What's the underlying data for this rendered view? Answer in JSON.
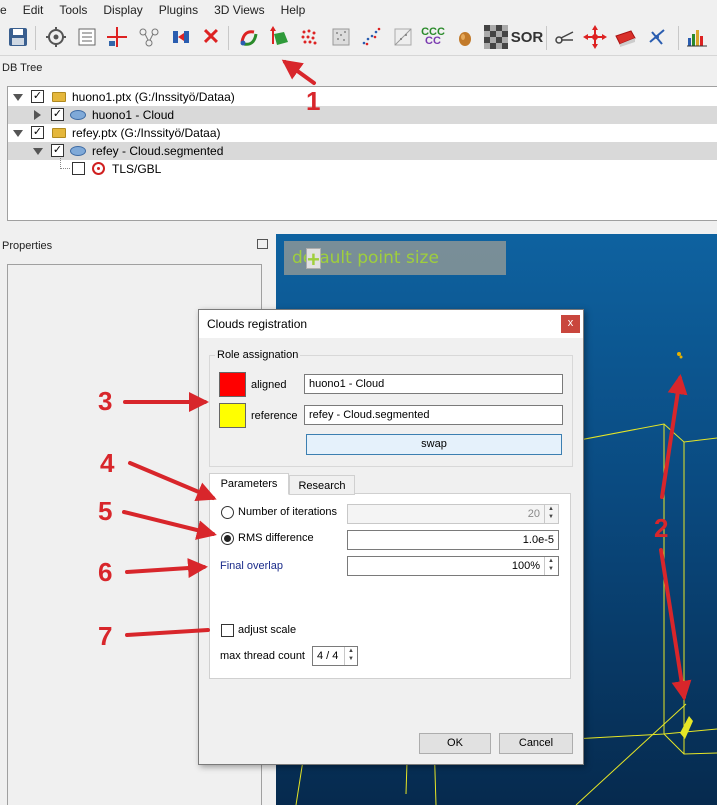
{
  "menu": [
    "e",
    "Edit",
    "Tools",
    "Display",
    "Plugins",
    "3D Views",
    "Help"
  ],
  "toolbar_icons": [
    "save-icon",
    "settings-icon",
    "list-icon",
    "point-pick-icon",
    "graph-icon",
    "export-icon",
    "delete-icon",
    "register-icon",
    "normals-icon",
    "color-icon",
    "sample-icon",
    "density-icon",
    "noise-icon",
    "ccc-icon",
    "leaf-icon",
    "grid-icon",
    "sor-icon",
    "scissors-icon",
    "move-icon",
    "plane-icon",
    "star-icon",
    "histogram-icon"
  ],
  "toolbar_text": {
    "ccc": "CCC",
    "sor": "SOR"
  },
  "dbtree": {
    "title": "DB Tree",
    "rows": [
      {
        "label": "huono1.ptx (G:/Inssityö/Dataa)",
        "checked": "✓"
      },
      {
        "label": "huono1 - Cloud",
        "checked": "✓"
      },
      {
        "label": "refey.ptx (G:/Inssityö/Dataa)",
        "checked": "✓"
      },
      {
        "label": "refey - Cloud.segmented",
        "checked": "✓"
      },
      {
        "label": "TLS/GBL",
        "checked": ""
      }
    ]
  },
  "properties": {
    "title": "Properties"
  },
  "view3d": {
    "point_size_label": "default point size",
    "minus": "−",
    "plus": "+"
  },
  "dialog": {
    "title": "Clouds registration",
    "close": "x",
    "role_group": "Role assignation",
    "aligned_label": "aligned",
    "aligned_value": "huono1 - Cloud",
    "aligned_color": "#ff0000",
    "reference_label": "reference",
    "reference_value": "refey - Cloud.segmented",
    "reference_color": "#ffff00",
    "swap": "swap",
    "tabs": [
      "Parameters",
      "Research"
    ],
    "iterations_label": "Number of iterations",
    "iterations_value": "20",
    "rms_label": "RMS difference",
    "rms_value": "1.0e-5",
    "overlap_label": "Final overlap",
    "overlap_value": "100%",
    "adjust_scale_label": "adjust scale",
    "thread_label": "max thread count",
    "thread_value": "4 / 4",
    "ok": "OK",
    "cancel": "Cancel"
  },
  "annotations": [
    "1",
    "2",
    "3",
    "4",
    "5",
    "6",
    "7"
  ],
  "colors": {
    "annotation": "#d8262b",
    "view_bg": "#0a4a80",
    "overlay_text": "#9fcf3c"
  }
}
